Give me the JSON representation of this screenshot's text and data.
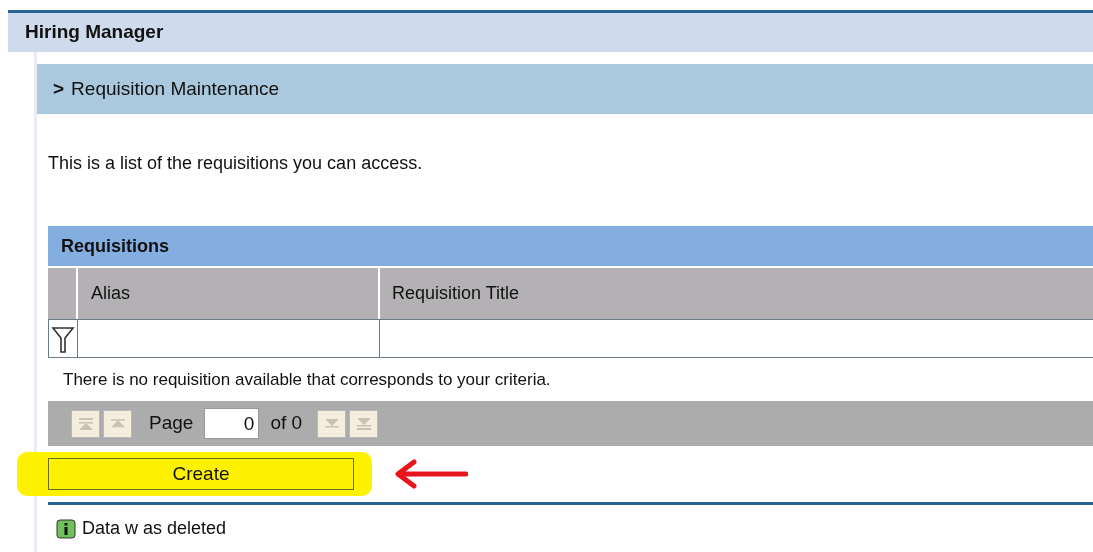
{
  "header": {
    "title": "Hiring Manager"
  },
  "section": {
    "expander": ">",
    "title": "Requisition Maintenance"
  },
  "intro": "This is a list of the requisitions you can access.",
  "table": {
    "title": "Requisitions",
    "columns": [
      "Alias",
      "Requisition Title"
    ],
    "empty_message": "There is no requisition available that corresponds to your criteria.",
    "pager": {
      "label": "Page",
      "value": "0",
      "of": "of 0",
      "disabled": true
    }
  },
  "create_button": {
    "label": "Create",
    "highlighted": true
  },
  "message": "Data w as deleted"
}
